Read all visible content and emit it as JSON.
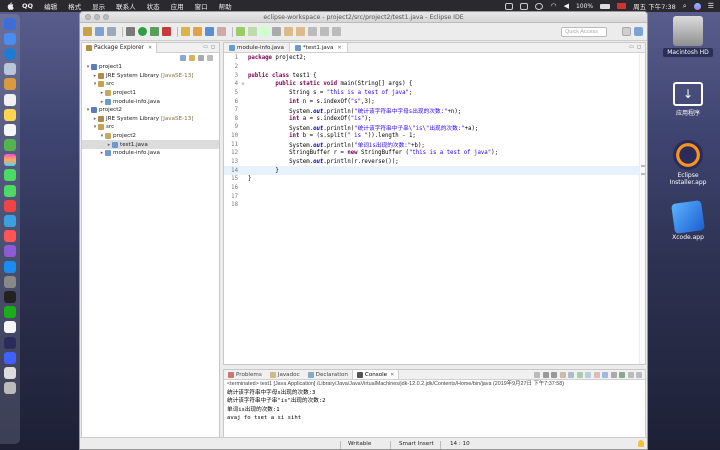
{
  "menubar": {
    "app": "QQ",
    "items": [
      "编辑",
      "格式",
      "显示",
      "联系人",
      "状态",
      "应用",
      "窗口",
      "帮助"
    ],
    "battery": "100%",
    "clock": "周五 下午7:38"
  },
  "desktop": {
    "icons": [
      {
        "label": "Macintosh HD"
      },
      {
        "label": "应用程序"
      },
      {
        "label": "Eclipse Installer.app"
      },
      {
        "label": "Xcode.app"
      }
    ]
  },
  "window": {
    "title": "eclipse-workspace - project2/src/project2/test1.java - Eclipse IDE",
    "quick_access": "Quick Access"
  },
  "package_explorer": {
    "tab_label": "Package Explorer",
    "tree": [
      {
        "label": "project1",
        "depth": 0,
        "arrow": "▾",
        "icon": "project-icon"
      },
      {
        "label": "JRE System Library",
        "decoration": "[JavaSE-13]",
        "depth": 1,
        "arrow": "▸",
        "icon": "library-icon"
      },
      {
        "label": "src",
        "depth": 1,
        "arrow": "▾",
        "icon": "source-folder-icon"
      },
      {
        "label": "project1",
        "depth": 2,
        "arrow": "▸",
        "icon": "package-icon"
      },
      {
        "label": "module-info.java",
        "depth": 2,
        "arrow": "▸",
        "icon": "java-file-icon"
      },
      {
        "label": "project2",
        "depth": 0,
        "arrow": "▾",
        "icon": "project-icon"
      },
      {
        "label": "JRE System Library",
        "decoration": "[JavaSE-13]",
        "depth": 1,
        "arrow": "▸",
        "icon": "library-icon"
      },
      {
        "label": "src",
        "depth": 1,
        "arrow": "▾",
        "icon": "source-folder-icon"
      },
      {
        "label": "project2",
        "depth": 2,
        "arrow": "▾",
        "icon": "package-icon"
      },
      {
        "label": "test1.java",
        "depth": 3,
        "arrow": "▸",
        "icon": "java-file-icon",
        "selected": true
      },
      {
        "label": "module-info.java",
        "depth": 2,
        "arrow": "▸",
        "icon": "java-file-icon"
      }
    ]
  },
  "editor": {
    "tabs": [
      {
        "label": "module-info.java",
        "active": false
      },
      {
        "label": "*test1.java",
        "active": true
      }
    ],
    "lines": [
      {
        "n": "1",
        "html": "<span class=\"kw\">package</span> project2;"
      },
      {
        "n": "2",
        "html": ""
      },
      {
        "n": "3",
        "html": "<span class=\"kw\">public class</span> test1 {"
      },
      {
        "n": "4",
        "fold": "⊖",
        "html": "        <span class=\"kw\">public static void</span> main(String[] args) {"
      },
      {
        "n": "5",
        "html": "            String s = <span class=\"str\">\"this is a test of java\"</span>;"
      },
      {
        "n": "6",
        "html": "            <span class=\"kw\">int</span> n = s.indexOf(<span class=\"str\">\"s\"</span>,3);"
      },
      {
        "n": "7",
        "html": "            System.<span class=\"fld\">out</span>.println(<span class=\"str\">\"统计该字符串中字母s出现的次数:\"</span>+n);"
      },
      {
        "n": "8",
        "html": "            <span class=\"kw\">int</span> a = s.indexOf(<span class=\"str\">\"is\"</span>);"
      },
      {
        "n": "9",
        "html": "            System.<span class=\"fld\">out</span>.println(<span class=\"str\">\"统计该字符串中子串\\\"is\\\"出现的次数:\"</span>+a);"
      },
      {
        "n": "10",
        "html": "            <span class=\"kw\">int</span> b = (s.split(<span class=\"str\">\" is \"</span>)).length - 1;"
      },
      {
        "n": "11",
        "html": "            System.<span class=\"fld\">out</span>.println(<span class=\"str\">\"单词is出现的次数:\"</span>+b);"
      },
      {
        "n": "12",
        "html": "            StringBuffer r = <span class=\"kw\">new</span> StringBuffer (<span class=\"str\">\"this is a test of java\"</span>);"
      },
      {
        "n": "13",
        "html": "            System.<span class=\"fld\">out</span>.println(r.reverse());"
      },
      {
        "n": "14",
        "html": "        }",
        "current": true
      },
      {
        "n": "15",
        "html": "}"
      },
      {
        "n": "16",
        "html": ""
      },
      {
        "n": "17",
        "html": ""
      },
      {
        "n": "18",
        "html": ""
      }
    ]
  },
  "console": {
    "tabs": [
      {
        "label": "Problems",
        "active": false
      },
      {
        "label": "Javadoc",
        "active": false
      },
      {
        "label": "Declaration",
        "active": false
      },
      {
        "label": "Console",
        "active": true
      }
    ],
    "terminated": "<terminated> test1 [Java Application] /Library/Java/JavaVirtualMachines/jdk-12.0.2.jdk/Contents/Home/bin/java (2019年9月27日 下午7:37:58)",
    "output": [
      "统计该字符串中字母s出现的次数:3",
      "统计该字符串中子串\"is\"出现的次数:2",
      "单词is出现的次数:1",
      "avaj fo tset a si siht"
    ]
  },
  "statusbar": {
    "writable": "Writable",
    "insert_mode": "Smart Insert",
    "position": "14 : 10"
  },
  "colors": {
    "keyword": "#7f0055",
    "string": "#2a00ff",
    "field": "#0000c0",
    "current_line": "#e8f2fe"
  }
}
